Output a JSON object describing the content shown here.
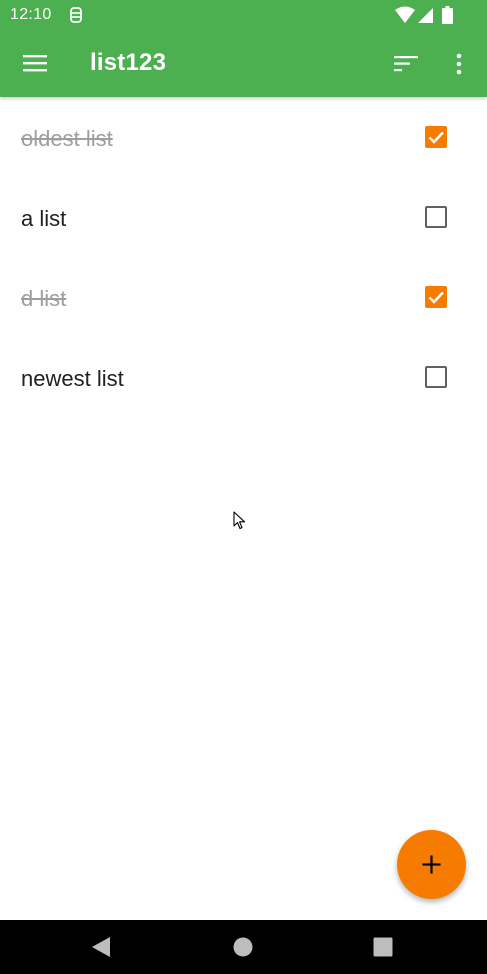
{
  "status_bar": {
    "time": "12:10",
    "icons": [
      "notification-icon",
      "wifi-icon",
      "cell-signal-icon",
      "battery-icon"
    ]
  },
  "app_bar": {
    "title": "list123",
    "nav_icon": "hamburger-menu-icon",
    "actions": [
      "sort-icon",
      "more-vert-icon"
    ]
  },
  "lists": [
    {
      "label": "oldest list",
      "checked": true
    },
    {
      "label": "a list",
      "checked": false
    },
    {
      "label": "d list",
      "checked": true
    },
    {
      "label": "newest list",
      "checked": false
    }
  ],
  "fab": {
    "icon": "plus-icon"
  },
  "nav_bar": {
    "icons": [
      "back-icon",
      "home-icon",
      "recents-icon"
    ]
  },
  "colors": {
    "primary": "#4caf50",
    "accent": "#f57c00",
    "text": "#212121",
    "done_text": "#9e9e9e",
    "unchecked_border": "#616161"
  }
}
